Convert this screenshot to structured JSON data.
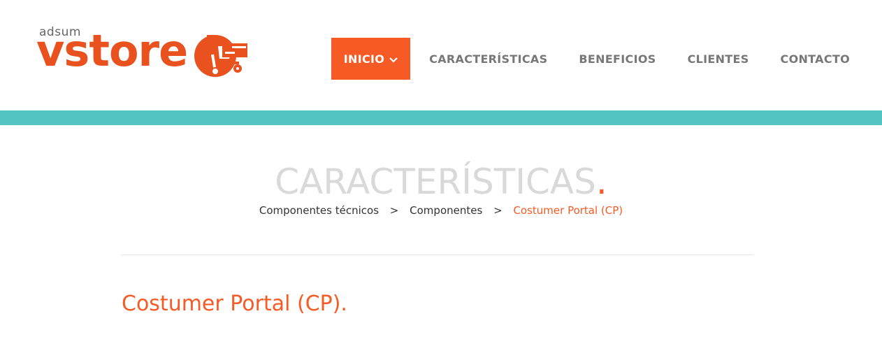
{
  "logo": {
    "small_text": "adsum",
    "brand_text": "vstore",
    "icon": "shopping-cart-icon",
    "color": "#e9521e"
  },
  "nav": {
    "items": [
      {
        "label": "INICIO",
        "active": true,
        "icon": "chevron-down-icon"
      },
      {
        "label": "CARACTERÍSTICAS",
        "active": false
      },
      {
        "label": "BENEFICIOS",
        "active": false
      },
      {
        "label": "CLIENTES",
        "active": false
      },
      {
        "label": "CONTACTO",
        "active": false
      }
    ],
    "active_color": "#f65a25",
    "text_color": "#777777"
  },
  "banner_color": "#52c4c2",
  "page": {
    "title": "CARACTERÍSTICAS",
    "title_dot": ".",
    "breadcrumb": {
      "items": [
        "Componentes técnicos",
        "Componentes"
      ],
      "separator": ">",
      "current": "Costumer Portal (CP)"
    },
    "section_title": "Costumer Portal (CP)."
  },
  "accent_color": "#f65a25"
}
